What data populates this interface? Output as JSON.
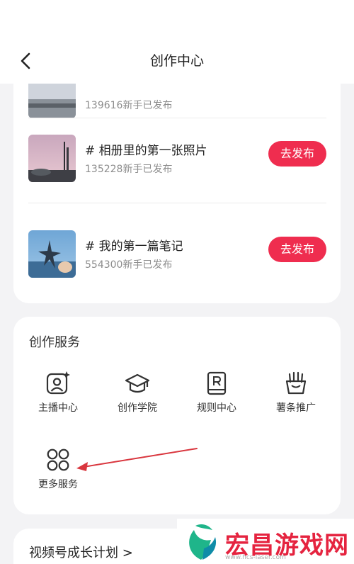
{
  "header": {
    "title": "创作中心"
  },
  "topics": [
    {
      "title": "",
      "subtitle": "139616新手已发布"
    },
    {
      "title": "# 相册里的第一张照片",
      "subtitle": "135228新手已发布",
      "button": "去发布"
    },
    {
      "title": "# 我的第一篇笔记",
      "subtitle": "554300新手已发布",
      "button": "去发布"
    }
  ],
  "services": {
    "title": "创作服务",
    "items": [
      {
        "label": "主播中心",
        "icon": "anchor-center-icon"
      },
      {
        "label": "创作学院",
        "icon": "graduation-cap-icon"
      },
      {
        "label": "规则中心",
        "icon": "rule-book-icon"
      },
      {
        "label": "薯条推广",
        "icon": "fries-icon"
      },
      {
        "label": "更多服务",
        "icon": "more-grid-icon"
      }
    ]
  },
  "growth": {
    "label": "视频号成长计划 >"
  },
  "watermark": {
    "text": "宏昌游戏网",
    "url": "www.hcs-laser.com"
  },
  "colors": {
    "accent": "#ef2d4f",
    "background": "#f3f3f5",
    "annotation_arrow": "#d9363e"
  }
}
